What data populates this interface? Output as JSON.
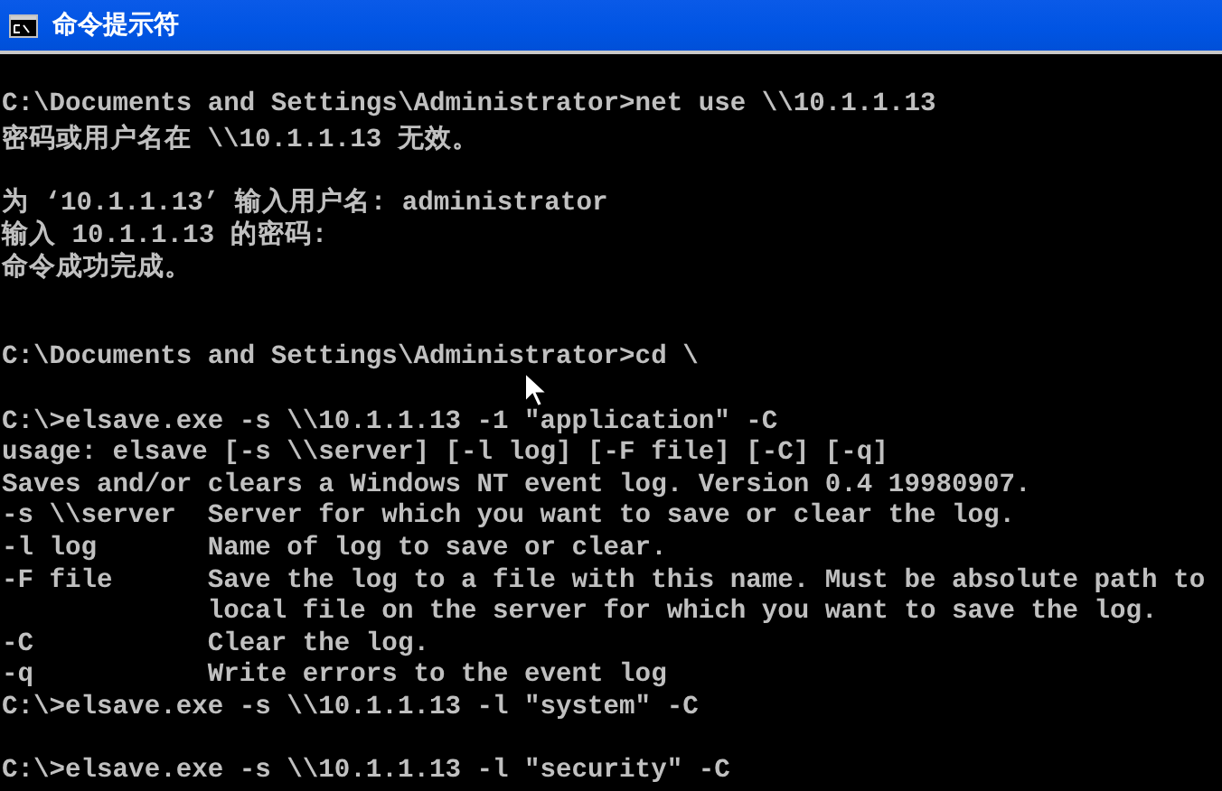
{
  "window": {
    "title": "命令提示符"
  },
  "console": {
    "lines": [
      {
        "kind": "blank"
      },
      {
        "kind": "text",
        "text": "C:\\Documents and Settings\\Administrator>net use \\\\10.1.1.13"
      },
      {
        "kind": "text",
        "text": "密码或用户名在 \\\\10.1.1.13 无效。"
      },
      {
        "kind": "blank"
      },
      {
        "kind": "text",
        "text": "为 ‘10.1.1.13’ 输入用户名: administrator"
      },
      {
        "kind": "text",
        "text": "输入 10.1.1.13 的密码:"
      },
      {
        "kind": "text",
        "text": "命令成功完成。"
      },
      {
        "kind": "blank"
      },
      {
        "kind": "blank"
      },
      {
        "kind": "text",
        "text": "C:\\Documents and Settings\\Administrator>cd \\"
      },
      {
        "kind": "blank"
      },
      {
        "kind": "text",
        "text": "C:\\>elsave.exe -s \\\\10.1.1.13 -1 \"application\" -C"
      },
      {
        "kind": "text",
        "text": "usage: elsave [-s \\\\server] [-l log] [-F file] [-C] [-q]"
      },
      {
        "kind": "text",
        "text": "Saves and/or clears a Windows NT event log. Version 0.4 19980907."
      },
      {
        "kind": "text",
        "text": "-s \\\\server  Server for which you want to save or clear the log."
      },
      {
        "kind": "text",
        "text": "-l log       Name of log to save or clear."
      },
      {
        "kind": "text",
        "text": "-F file      Save the log to a file with this name. Must be absolute path to"
      },
      {
        "kind": "text",
        "text": "             local file on the server for which you want to save the log."
      },
      {
        "kind": "text",
        "text": "-C           Clear the log."
      },
      {
        "kind": "text",
        "text": "-q           Write errors to the event log"
      },
      {
        "kind": "text",
        "text": "C:\\>elsave.exe -s \\\\10.1.1.13 -l \"system\" -C"
      },
      {
        "kind": "blank"
      },
      {
        "kind": "text",
        "text": "C:\\>elsave.exe -s \\\\10.1.1.13 -l \"security\" -C"
      }
    ]
  }
}
